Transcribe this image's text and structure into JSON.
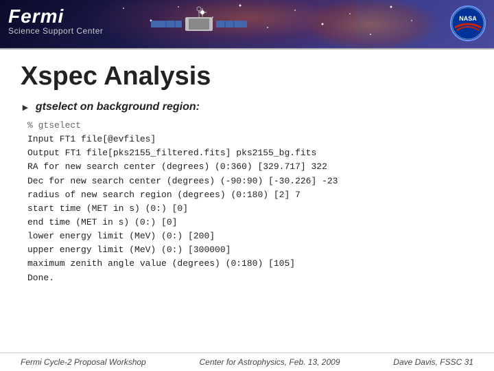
{
  "header": {
    "fermi_label": "Fermi",
    "ssc_label": "Science Support Center",
    "nasa_label": "NASA"
  },
  "page": {
    "title": "Xspec Analysis",
    "bullet": {
      "label": "gtselect on background region:"
    },
    "code_lines": [
      "% gtselect",
      "Input FT1 file[@evfiles]",
      "Output FT1 file[pks2155_filtered.fits] pks2155_bg.fits",
      "RA for new search center (degrees) (0:360) [329.717] 322",
      "Dec for new search center (degrees) (-90:90) [-30.226] -23",
      "radius of new search region (degrees) (0:180) [2] 7",
      "start time (MET in s) (0:) [0]",
      "end time (MET in s) (0:) [0]",
      "lower energy limit (MeV) (0:) [200]",
      "upper energy limit (MeV) (0:) [300000]",
      "maximum zenith angle value (degrees) (0:180) [105]",
      "Done."
    ]
  },
  "footer": {
    "left": "Fermi Cycle-2 Proposal Workshop",
    "center": "Center for Astrophysics,  Feb. 13, 2009",
    "right": "Dave Davis, FSSC 31"
  }
}
